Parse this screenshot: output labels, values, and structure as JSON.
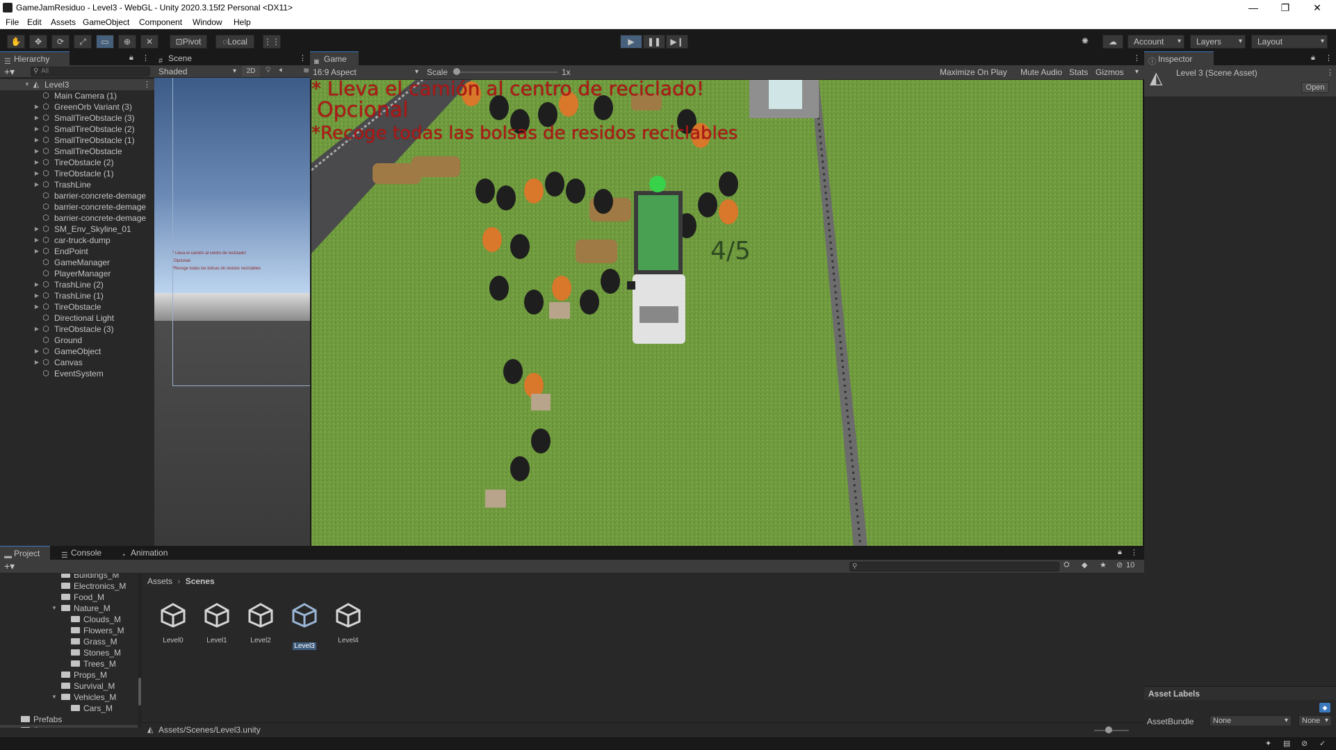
{
  "window": {
    "title": "GameJamResiduo - Level3 - WebGL - Unity 2020.3.15f2 Personal <DX11>",
    "minimize": "—",
    "restore": "❐",
    "close": "✕"
  },
  "menu": [
    "File",
    "Edit",
    "Assets",
    "GameObject",
    "Component",
    "Window",
    "Help"
  ],
  "toolbar": {
    "pivot": "Pivot",
    "local": "Local",
    "account": "Account",
    "layers": "Layers",
    "layout": "Layout"
  },
  "hierarchy": {
    "tab": "Hierarchy",
    "search_placeholder": "All",
    "root": "Level3",
    "items": [
      {
        "label": "Main Camera (1)",
        "expandable": false
      },
      {
        "label": "GreenOrb Variant (3)",
        "expandable": true
      },
      {
        "label": "SmallTireObstacle (3)",
        "expandable": true
      },
      {
        "label": "SmallTireObstacle (2)",
        "expandable": true
      },
      {
        "label": "SmallTireObstacle (1)",
        "expandable": true
      },
      {
        "label": "SmallTireObstacle",
        "expandable": true
      },
      {
        "label": "TireObstacle (2)",
        "expandable": true
      },
      {
        "label": "TireObstacle (1)",
        "expandable": true
      },
      {
        "label": "TrashLine",
        "expandable": true
      },
      {
        "label": "barrier-concrete-demage",
        "expandable": false
      },
      {
        "label": "barrier-concrete-demage",
        "expandable": false
      },
      {
        "label": "barrier-concrete-demage",
        "expandable": false
      },
      {
        "label": "SM_Env_Skyline_01",
        "expandable": true
      },
      {
        "label": "car-truck-dump",
        "expandable": true
      },
      {
        "label": "EndPoint",
        "expandable": true
      },
      {
        "label": "GameManager",
        "expandable": false
      },
      {
        "label": "PlayerManager",
        "expandable": false
      },
      {
        "label": "TrashLine (2)",
        "expandable": true
      },
      {
        "label": "TrashLine (1)",
        "expandable": true
      },
      {
        "label": "TireObstacle",
        "expandable": true
      },
      {
        "label": "Directional Light",
        "expandable": false
      },
      {
        "label": "TireObstacle (3)",
        "expandable": true
      },
      {
        "label": "Ground",
        "expandable": false
      },
      {
        "label": "GameObject",
        "expandable": true
      },
      {
        "label": "Canvas",
        "expandable": true
      },
      {
        "label": "EventSystem",
        "expandable": false
      }
    ]
  },
  "scene": {
    "tab": "Scene",
    "shading": "Shaded",
    "mode_2d": "2D",
    "mini_text": [
      "* Lleva el camión al centro de reciclado!",
      "Opcional",
      "*Recoge todas las bolsas de residos reciclables"
    ]
  },
  "game": {
    "tab": "Game",
    "aspect": "16:9 Aspect",
    "scale_label": "Scale",
    "scale_value": "1x",
    "maximize": "Maximize On Play",
    "mute": "Mute Audio",
    "stats": "Stats",
    "gizmos": "Gizmos",
    "hud_line1": "* Lleva el camión al centro de reciclado!",
    "hud_line2": "Opcional",
    "hud_line3": "*Recoge todas las bolsas de residos reciclables",
    "counter": "4/5",
    "colors": {
      "grass": "#6f9a3e",
      "road": "#4a4a4c",
      "hud_text": "#b01a18"
    }
  },
  "inspector": {
    "tab": "Inspector",
    "asset_title": "Level 3 (Scene Asset)",
    "open_button": "Open",
    "asset_labels": "Asset Labels",
    "assetbundle_label": "AssetBundle",
    "assetbundle_value": "None",
    "variant_value": "None"
  },
  "bottom_tabs": [
    "Project",
    "Console",
    "Animation"
  ],
  "project": {
    "hidden_count": "10",
    "breadcrumb_root": "Assets",
    "breadcrumb_current": "Scenes",
    "folders": [
      {
        "label": "Buildings_M",
        "indent": 1,
        "expanded": false
      },
      {
        "label": "Electronics_M",
        "indent": 1,
        "expanded": false
      },
      {
        "label": "Food_M",
        "indent": 1,
        "expanded": false
      },
      {
        "label": "Nature_M",
        "indent": 1,
        "expanded": true
      },
      {
        "label": "Clouds_M",
        "indent": 2,
        "expanded": false
      },
      {
        "label": "Flowers_M",
        "indent": 2,
        "expanded": false
      },
      {
        "label": "Grass_M",
        "indent": 2,
        "expanded": false
      },
      {
        "label": "Stones_M",
        "indent": 2,
        "expanded": false
      },
      {
        "label": "Trees_M",
        "indent": 2,
        "expanded": false
      },
      {
        "label": "Props_M",
        "indent": 1,
        "expanded": false
      },
      {
        "label": "Survival_M",
        "indent": 1,
        "expanded": false
      },
      {
        "label": "Vehicles_M",
        "indent": 1,
        "expanded": true
      },
      {
        "label": "Cars_M",
        "indent": 2,
        "expanded": false
      },
      {
        "label": "Prefabs",
        "indent": 0,
        "expanded": false
      },
      {
        "label": "Scenes",
        "indent": 0,
        "expanded": false,
        "selected": true
      }
    ],
    "scenes": [
      {
        "label": "Level0",
        "selected": false
      },
      {
        "label": "Level1",
        "selected": false
      },
      {
        "label": "Level2",
        "selected": false
      },
      {
        "label": "Level3",
        "selected": true
      },
      {
        "label": "Level4",
        "selected": false
      }
    ],
    "path": "Assets/Scenes/Level3.unity"
  }
}
